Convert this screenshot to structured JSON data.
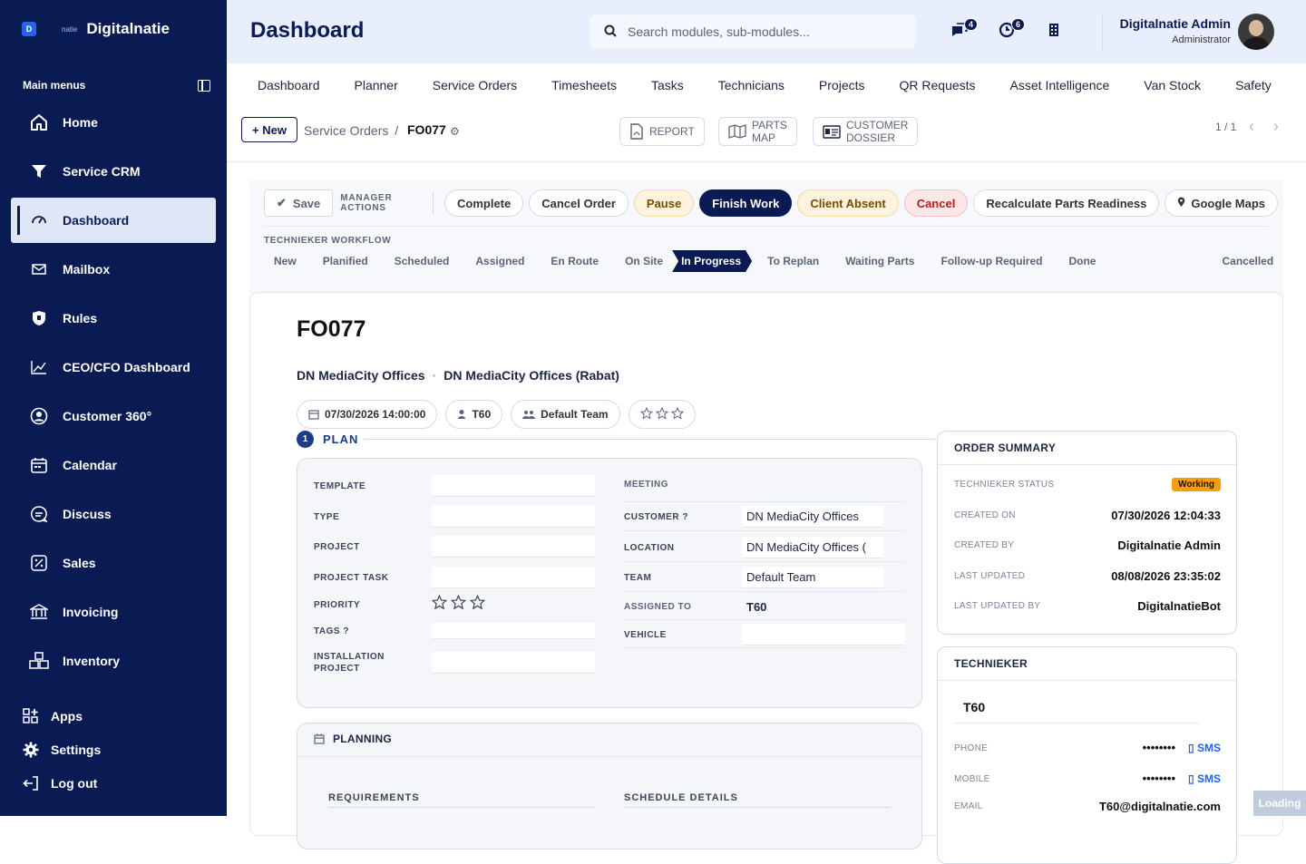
{
  "brand": {
    "logo_letter": "D",
    "small": "natie",
    "name": "Digitalnatie"
  },
  "sidebar": {
    "section_label": "Main menus",
    "items": [
      {
        "label": "Home",
        "icon": "home-icon"
      },
      {
        "label": "Service CRM",
        "icon": "filter-icon"
      },
      {
        "label": "Dashboard",
        "icon": "gauge-icon",
        "active": true
      },
      {
        "label": "Mailbox",
        "icon": "mail-icon"
      },
      {
        "label": "Rules",
        "icon": "shield-icon"
      },
      {
        "label": "CEO/CFO Dashboard",
        "icon": "trend-chart-icon"
      },
      {
        "label": "Customer 360°",
        "icon": "user-circle-icon"
      },
      {
        "label": "Calendar",
        "icon": "calendar-icon"
      },
      {
        "label": "Discuss",
        "icon": "chat-icon"
      },
      {
        "label": "Sales",
        "icon": "percent-icon"
      },
      {
        "label": "Invoicing",
        "icon": "bank-icon"
      },
      {
        "label": "Inventory",
        "icon": "boxes-icon"
      }
    ],
    "bottom": [
      {
        "label": "Apps",
        "icon": "apps-icon"
      },
      {
        "label": "Settings",
        "icon": "gear-icon"
      },
      {
        "label": "Log out",
        "icon": "logout-icon"
      }
    ]
  },
  "header": {
    "title": "Dashboard",
    "search_placeholder": "Search modules, sub-modules...",
    "chat_badge": "4",
    "activity_badge": "6",
    "user_name": "Digitalnatie Admin",
    "user_role": "Administrator"
  },
  "tabs": [
    "Dashboard",
    "Planner",
    "Service Orders",
    "Timesheets",
    "Tasks",
    "Technicians",
    "Projects",
    "QR Requests",
    "Asset Intelligence",
    "Van Stock",
    "Safety"
  ],
  "breadcrumb": {
    "new_label": "+ New",
    "parent": "Service Orders",
    "separator": "/",
    "current": "FO077",
    "report": "REPORT",
    "parts_map_1": "PARTS",
    "parts_map_2": "MAP",
    "dossier_1": "CUSTOMER",
    "dossier_2": "DOSSIER",
    "pager": "1 / 1"
  },
  "actions": {
    "save": "Save",
    "manager_label": "MANAGER ACTIONS",
    "complete": "Complete",
    "cancel_order": "Cancel Order",
    "pause": "Pause",
    "finish": "Finish Work",
    "absent": "Client Absent",
    "cancel": "Cancel",
    "recalc": "Recalculate Parts Readiness",
    "maps": "Google Maps"
  },
  "workflow": {
    "title": "TECHNIEKER WORKFLOW",
    "steps": [
      "New",
      "Planified",
      "Scheduled",
      "Assigned",
      "En Route",
      "On Site",
      "In Progress",
      "To Replan",
      "Waiting Parts",
      "Follow-up Required",
      "Done",
      "Cancelled"
    ],
    "active": "In Progress"
  },
  "order": {
    "title": "FO077",
    "customer": "DN MediaCity Offices",
    "site": "DN MediaCity Offices (Rabat)",
    "date": "07/30/2026 14:00:00",
    "tech": "T60",
    "team": "Default Team",
    "rating_stars": 3
  },
  "plan": {
    "num": "1",
    "label": "PLAN",
    "left_fields": [
      {
        "label": "TEMPLATE",
        "value": ""
      },
      {
        "label": "TYPE",
        "value": ""
      },
      {
        "label": "PROJECT",
        "value": ""
      },
      {
        "label": "PROJECT TASK",
        "value": ""
      },
      {
        "label": "PRIORITY",
        "value": ""
      },
      {
        "label": "TAGS ?",
        "value": ""
      },
      {
        "label": "INSTALLATION PROJECT",
        "value": ""
      }
    ],
    "right_fields": [
      {
        "label": "MEETING",
        "value": ""
      },
      {
        "label": "CUSTOMER ?",
        "value": "DN MediaCity Offices"
      },
      {
        "label": "LOCATION",
        "value": "DN MediaCity Offices ("
      },
      {
        "label": "TEAM",
        "value": "Default Team"
      },
      {
        "label": "ASSIGNED TO",
        "value": "T60"
      },
      {
        "label": "VEHICLE",
        "value": ""
      }
    ]
  },
  "planning": {
    "title": "PLANNING",
    "req": "REQUIREMENTS",
    "sched": "SCHEDULE DETAILS"
  },
  "summary": {
    "title": "ORDER SUMMARY",
    "rows": [
      {
        "label": "TECHNIEKER STATUS",
        "value": "Working"
      },
      {
        "label": "CREATED ON",
        "value": "07/30/2026 12:04:33"
      },
      {
        "label": "CREATED BY",
        "value": "Digitalnatie Admin"
      },
      {
        "label": "LAST UPDATED",
        "value": "08/08/2026 23:35:02"
      },
      {
        "label": "LAST UPDATED BY",
        "value": "DigitalnatieBot"
      }
    ],
    "status_color": "#f59e0b"
  },
  "technieker": {
    "title": "TECHNIEKER",
    "name": "T60",
    "phone_label": "PHONE",
    "phone": "••••••••",
    "mobile_label": "MOBILE",
    "mobile": "••••••••",
    "sms": "▯ SMS",
    "email_label": "EMAIL",
    "email": "T60@digitalnatie.com"
  },
  "loading": "Loading",
  "colors": {
    "navy": "#0a1a52",
    "accent": "#1e3a8a",
    "pause_bg": "#fdf3dc",
    "cancel_bg": "#fde8e8"
  }
}
